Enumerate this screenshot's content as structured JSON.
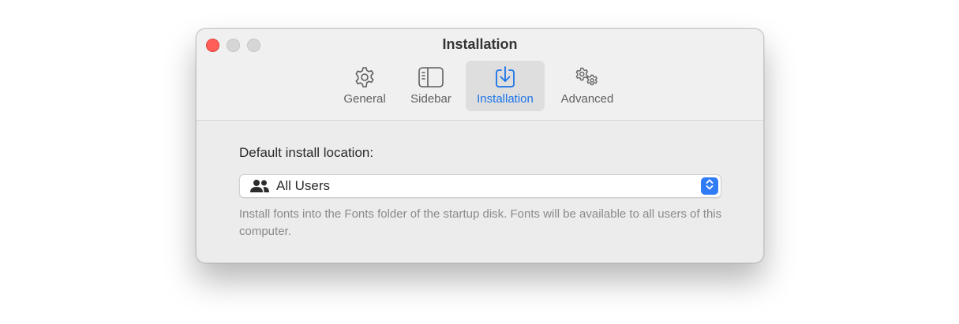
{
  "window": {
    "title": "Installation"
  },
  "toolbar": {
    "tabs": [
      {
        "label": "General",
        "icon": "gear-icon",
        "active": false
      },
      {
        "label": "Sidebar",
        "icon": "sidebar-icon",
        "active": false
      },
      {
        "label": "Installation",
        "icon": "download-tray-icon",
        "active": true
      },
      {
        "label": "Advanced",
        "icon": "gears-icon",
        "active": false
      }
    ]
  },
  "install": {
    "label": "Default install location:",
    "selected": "All Users",
    "selected_icon": "users-icon",
    "help": "Install fonts into the Fonts folder of the startup disk. Fonts will be available to all users of this computer."
  },
  "colors": {
    "accent": "#1a73e8",
    "close": "#ff5f57",
    "stepper": "#2f7cf6"
  }
}
